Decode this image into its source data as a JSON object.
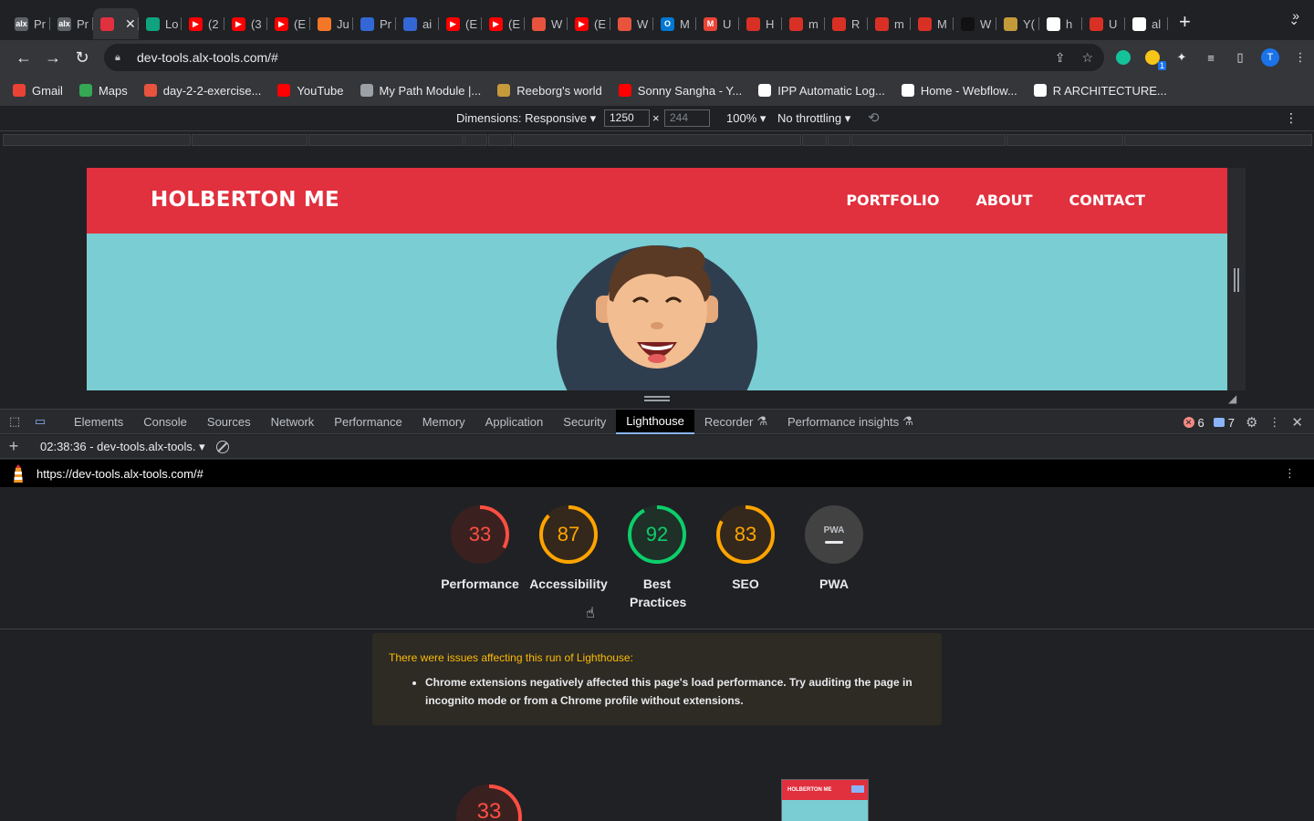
{
  "browser": {
    "tabs": [
      {
        "label": "Pr",
        "color": "#5f6368",
        "glyph": "alx"
      },
      {
        "label": "Pr",
        "color": "#5f6368",
        "glyph": "alx"
      },
      {
        "label": "",
        "color": "#e1303e",
        "glyph": "",
        "active": true
      },
      {
        "label": "Lo",
        "color": "#10a37f",
        "glyph": ""
      },
      {
        "label": "(2",
        "color": "#ff0000",
        "glyph": "▶"
      },
      {
        "label": "(3",
        "color": "#ff0000",
        "glyph": "▶"
      },
      {
        "label": "(E",
        "color": "#ff0000",
        "glyph": "▶"
      },
      {
        "label": "Ju",
        "color": "#f37726",
        "glyph": ""
      },
      {
        "label": "Pr",
        "color": "#3367d6",
        "glyph": ""
      },
      {
        "label": "ai",
        "color": "#3367d6",
        "glyph": ""
      },
      {
        "label": "(E",
        "color": "#ff0000",
        "glyph": "▶"
      },
      {
        "label": "(E",
        "color": "#ff0000",
        "glyph": "▶"
      },
      {
        "label": "W",
        "color": "#e8533e",
        "glyph": ""
      },
      {
        "label": "(E",
        "color": "#ff0000",
        "glyph": "▶"
      },
      {
        "label": "W",
        "color": "#e8533e",
        "glyph": ""
      },
      {
        "label": "M",
        "color": "#0078d4",
        "glyph": "O"
      },
      {
        "label": "U",
        "color": "#ea4335",
        "glyph": "M"
      },
      {
        "label": "H",
        "color": "#d93025",
        "glyph": ""
      },
      {
        "label": "m",
        "color": "#d93025",
        "glyph": ""
      },
      {
        "label": "R",
        "color": "#d93025",
        "glyph": ""
      },
      {
        "label": "m",
        "color": "#d93025",
        "glyph": ""
      },
      {
        "label": "M",
        "color": "#d93025",
        "glyph": ""
      },
      {
        "label": "W",
        "color": "#111111",
        "glyph": ""
      },
      {
        "label": "Y(",
        "color": "#c49a3a",
        "glyph": ""
      },
      {
        "label": "h",
        "color": "#ffffff",
        "glyph": "G"
      },
      {
        "label": "U",
        "color": "#d93025",
        "glyph": ""
      },
      {
        "label": "al",
        "color": "#ffffff",
        "glyph": ""
      }
    ],
    "new_tab_icon": "+",
    "tab_search_icon": "⌄",
    "url": "dev-tools.alx-tools.com/#",
    "profile_initial": "T",
    "extension_badge": "1",
    "bookmarks": [
      {
        "label": "Gmail",
        "color": "#ea4335"
      },
      {
        "label": "Maps",
        "color": "#34a853"
      },
      {
        "label": "day-2-2-exercise...",
        "color": "#e8533e"
      },
      {
        "label": "YouTube",
        "color": "#ff0000"
      },
      {
        "label": "My Path Module |...",
        "color": "#9aa0a6"
      },
      {
        "label": "Reeborg's world",
        "color": "#c49a3a"
      },
      {
        "label": "Sonny Sangha - Y...",
        "color": "#ff0000"
      },
      {
        "label": "IPP Automatic Log...",
        "color": "#ffffff"
      },
      {
        "label": "Home - Webflow...",
        "color": "#ffffff"
      },
      {
        "label": "R ARCHITECTURE...",
        "color": "#ffffff"
      }
    ],
    "bookmarks_more": "»"
  },
  "device_toolbar": {
    "dimensions_label": "Dimensions: Responsive ▾",
    "width_value": "1250",
    "height_placeholder": "244",
    "times": "×",
    "zoom": "100% ▾",
    "throttling": "No throttling ▾"
  },
  "site": {
    "logo": "HOLBERTON ME",
    "nav": [
      "PORTFOLIO",
      "ABOUT",
      "CONTACT"
    ],
    "header_color": "#e1303e",
    "hero_color": "#79cdd3"
  },
  "devtools": {
    "tabs": [
      "Elements",
      "Console",
      "Sources",
      "Network",
      "Performance",
      "Memory",
      "Application",
      "Security",
      "Lighthouse",
      "Recorder",
      "Performance insights"
    ],
    "active_tab": "Lighthouse",
    "error_count": "6",
    "message_count": "7",
    "report_select": "02:38:36 - dev-tools.alx-tools. ▾",
    "report_url": "https://dev-tools.alx-tools.com/#"
  },
  "lighthouse": {
    "scores": [
      {
        "label": "Performance",
        "value": 33,
        "color": "#ff4e42",
        "bg": "#3a2120"
      },
      {
        "label": "Accessibility",
        "value": 87,
        "color": "#ffa400",
        "bg": "#34281c"
      },
      {
        "label": "Best Practices",
        "value": 92,
        "color": "#0cce6b",
        "bg": "#1e3027"
      },
      {
        "label": "SEO",
        "value": 83,
        "color": "#ffa400",
        "bg": "#34281c"
      },
      {
        "label": "PWA",
        "value": null,
        "color": "#e8eaed",
        "bg": "#424242",
        "text": "PWA"
      }
    ],
    "warning_title": "There were issues affecting this run of Lighthouse:",
    "warning_items": [
      "Chrome extensions negatively affected this page's load performance. Try auditing the page in incognito mode or from a Chrome profile without extensions."
    ],
    "bottom_score": 33,
    "thumbnail_logo": "HOLBERTON ME"
  }
}
